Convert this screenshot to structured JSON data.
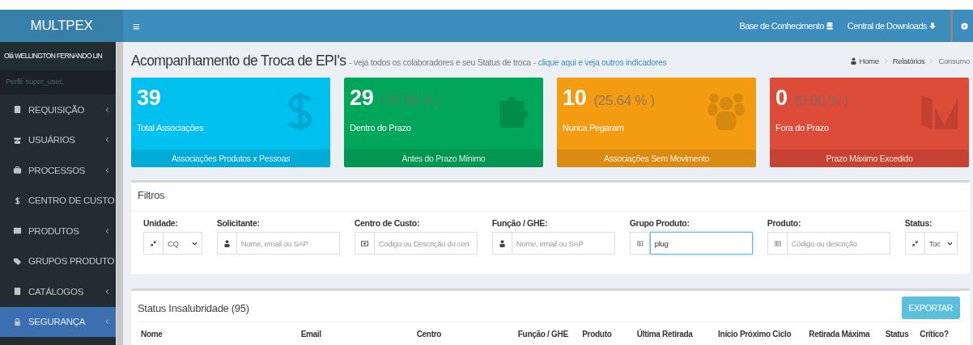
{
  "brand": "MULTPEX",
  "navbar": {
    "menu_glyph": "≡",
    "links": [
      "Base de Conhecimento",
      "Central de Downloads"
    ]
  },
  "sidebar": {
    "greeting": "Olá WELLINGTON FERNANDO LIN",
    "profile": "Perfil: super_user,",
    "items": [
      {
        "label": "REQUISIÇÃO",
        "selected": false
      },
      {
        "label": "USUÁRIOS",
        "selected": false
      },
      {
        "label": "PROCESSOS",
        "selected": false
      },
      {
        "label": "CENTRO DE CUSTO",
        "selected": false
      },
      {
        "label": "PRODUTOS",
        "selected": false
      },
      {
        "label": "GRUPOS PRODUTO",
        "selected": false
      },
      {
        "label": "CATÁLOGOS",
        "selected": false
      },
      {
        "label": "SEGURANÇA",
        "selected": true
      }
    ]
  },
  "page": {
    "title": "Acompanhamento de Troca de EPI's",
    "subtitle": "- veja todos os colaboradores e seu Status de troca -",
    "link": "clique aqui e veja outros indicadores",
    "breadcrumb": [
      "Home",
      "Relatórios",
      "Consumo"
    ]
  },
  "info_boxes": [
    {
      "number": "39",
      "label": "Total Associações",
      "footer": "Associações Produtos x Pessoas",
      "color": "#00c0ef"
    },
    {
      "number": "29",
      "percent": "(74.36 % )",
      "label": "Dentro do Prazo",
      "footer": "Antes do Prazo Mínimo",
      "color": "#00a65a"
    },
    {
      "number": "10",
      "percent": "(25.64 % )",
      "label": "Nunca Pegaram",
      "footer": "Associações Sem Movimento",
      "color": "#f39c12"
    },
    {
      "number": "0",
      "percent": "(0.00 % )",
      "label": "Fora do Prazo",
      "footer": "Prazo Máximo Excedido",
      "color": "#dd4b39"
    }
  ],
  "filters": {
    "title": "Filtros",
    "fields": [
      {
        "kind": "select",
        "label": "Unidade:",
        "value": "CQ"
      },
      {
        "kind": "input",
        "label": "Solicitante:",
        "placeholder": "Nome, email ou SAP"
      },
      {
        "kind": "input",
        "label": "Centro de Custo:",
        "placeholder": "Codigo ou Descrição do cen"
      },
      {
        "kind": "input",
        "label": "Função / GHE:",
        "placeholder": "Nome, email ou SAP"
      },
      {
        "kind": "input",
        "label": "Grupo Produto:",
        "value": "plug",
        "focused": true
      },
      {
        "kind": "input",
        "label": "Produto:",
        "placeholder": "Código ou descrição"
      },
      {
        "kind": "select",
        "label": "Status:",
        "value": "Toc"
      }
    ]
  },
  "table": {
    "title": "Status Insalubridade (95)",
    "export_button": "EXPORTAR",
    "columns": [
      "Nome",
      "Email",
      "Centro",
      "Função / GHE",
      "Produto",
      "Última Retirada",
      "Início Próximo Ciclo",
      "Retirada Máxima",
      "Status",
      "Crítico?"
    ]
  }
}
